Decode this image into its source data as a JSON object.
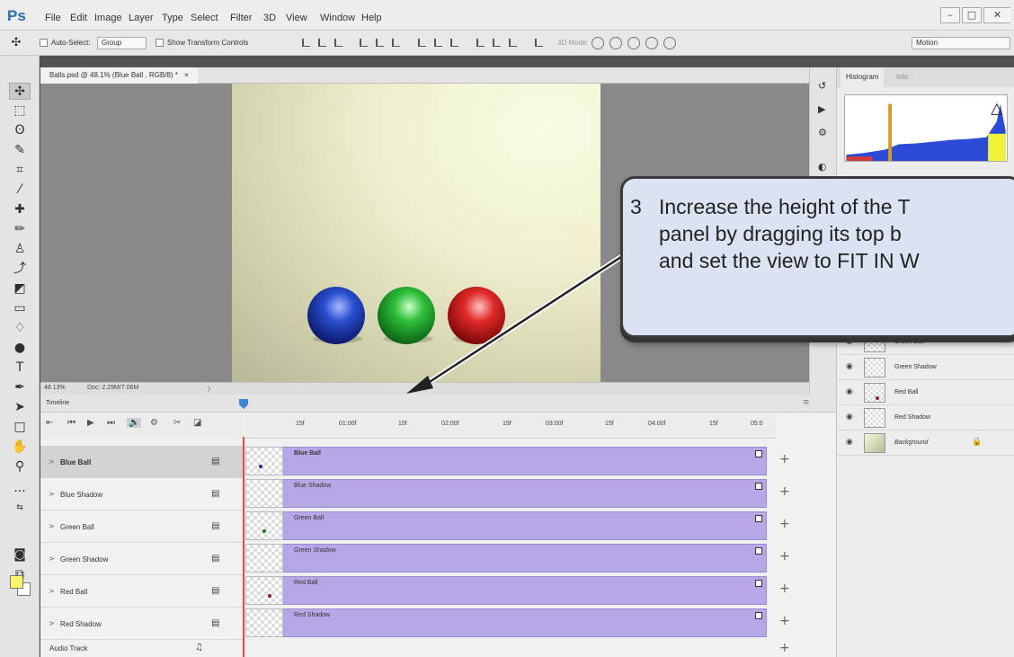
{
  "app": {
    "logo": "Ps"
  },
  "menu": [
    "File",
    "Edit",
    "Image",
    "Layer",
    "Type",
    "Select",
    "Filter",
    "3D",
    "View",
    "Window",
    "Help"
  ],
  "window_controls": {
    "minimize": "–",
    "maximize": "□",
    "close": "✕"
  },
  "options_bar": {
    "auto_select": "Auto-Select:",
    "group_value": "Group",
    "show_transform": "Show Transform Controls",
    "mode_3d": "3D Mode:",
    "workspace": "Motion"
  },
  "document": {
    "tab_title": "Balls.psd @ 48.1% (Blue Ball , RGB/8) *",
    "tab_close": "×",
    "zoom": "48.13%",
    "doc_info": "Doc: 2.29M/7.06M",
    "status_arrow": "〉"
  },
  "timeline": {
    "title": "Timeline",
    "ruler": [
      "15f",
      "01:00f",
      "15f",
      "02:00f",
      "15f",
      "03:00f",
      "15f",
      "04:00f",
      "15f",
      "05:0"
    ],
    "layers": [
      {
        "name": "Blue Ball",
        "clip": "Blue Ball",
        "dot": "#1c2f7a",
        "selected": true
      },
      {
        "name": "Blue Shadow",
        "clip": "Blue Shadow",
        "selected": false
      },
      {
        "name": "Green Ball",
        "clip": "Green Ball",
        "dot": "#1d7a1d",
        "selected": false
      },
      {
        "name": "Green Shadow",
        "clip": "Green Shadow",
        "selected": false
      },
      {
        "name": "Red Ball",
        "clip": "Red Ball",
        "dot": "#a21a1a",
        "selected": false
      },
      {
        "name": "Red Shadow",
        "clip": "Red Shadow",
        "selected": false
      }
    ],
    "audio_track": "Audio Track",
    "caret": ">",
    "plus": "+"
  },
  "right_panel": {
    "tabs": [
      "Histogram",
      "Info"
    ],
    "layers": [
      "Green Ball",
      "Green Shadow",
      "Red Ball",
      "Red Shadow",
      "Background"
    ]
  },
  "callout": {
    "number": "3",
    "lines": [
      "Increase the height of the T",
      "panel by dragging its top b",
      "and set the view to FIT IN W"
    ]
  },
  "colors": {
    "accent": "#2c6fae",
    "clip": "#b8a7e6",
    "playhead": "#e24b4b",
    "foreground": "#fff36b"
  }
}
